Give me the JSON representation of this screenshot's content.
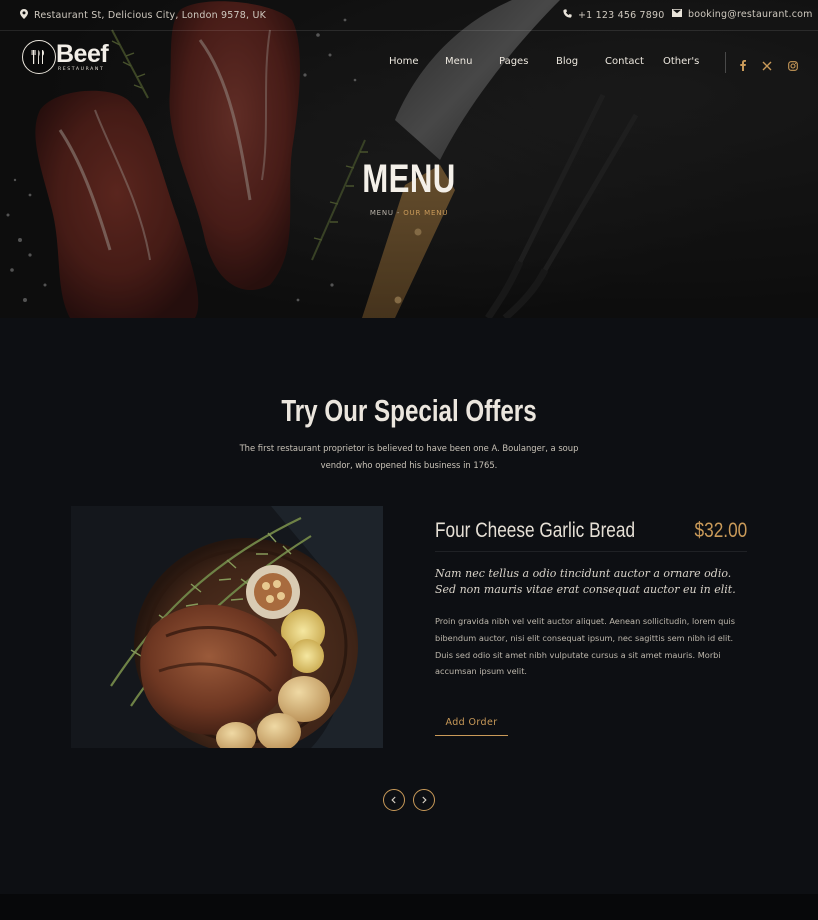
{
  "topbar": {
    "address": "Restaurant St, Delicious City, London 9578, UK",
    "phone": "+1 123 456 7890",
    "email": "booking@restaurant.com"
  },
  "brand": {
    "name": "Beef",
    "tagline": "RESTAURANT"
  },
  "nav": {
    "items": [
      "Home",
      "Menu",
      "Pages",
      "Blog",
      "Contact",
      "Other's"
    ]
  },
  "socials": [
    "facebook-icon",
    "x-icon",
    "instagram-icon"
  ],
  "hero": {
    "title": "MENU",
    "breadcrumb": [
      "MENU",
      "-",
      "OUR MENU"
    ]
  },
  "offers": {
    "title": "Try Our Special Offers",
    "subtitle": "The first restaurant proprietor is believed to have been one A. Boulanger, a soup vendor, who opened his business in 1765."
  },
  "dish": {
    "name": "Four Cheese Garlic Bread",
    "price": "$32.00",
    "quote": "Nam nec tellus a odio tincidunt auctor a ornare odio. Sed non mauris vitae erat consequat auctor eu in elit.",
    "description": "Proin gravida nibh vel velit auctor aliquet. Aenean sollicitudin, lorem quis bibendum auctor, nisi elit consequat ipsum, nec sagittis sem nibh id elit. Duis sed odio sit amet nibh vulputate cursus a sit amet mauris. Morbi accumsan ipsum velit.",
    "button": "Add Order"
  },
  "carousel": {
    "prev_icon": "chevron-left-icon",
    "next_icon": "chevron-right-icon"
  },
  "colors": {
    "background": "#0d0f13",
    "accent": "#c99a59",
    "text": "#ebe6de"
  }
}
